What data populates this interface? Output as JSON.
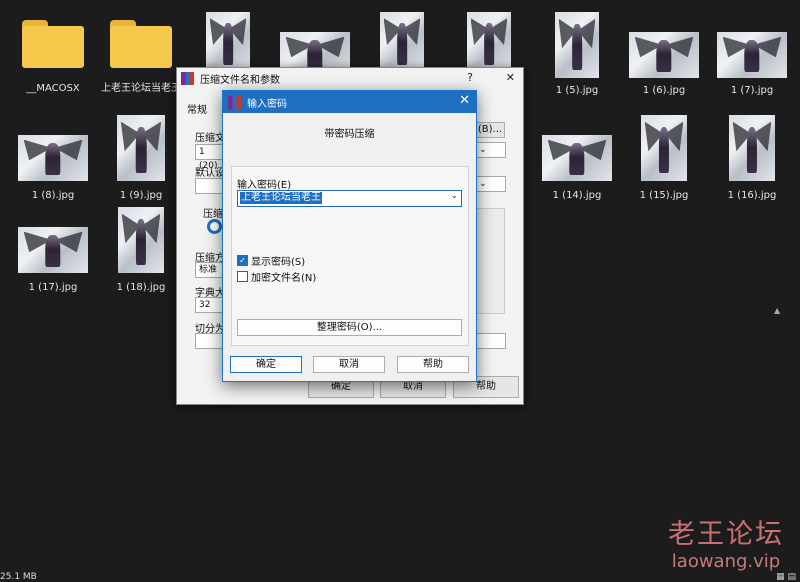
{
  "explorer": {
    "folders": [
      {
        "name": "__MACOSX"
      },
      {
        "name": "上老王论坛当老王"
      }
    ],
    "files_row1": [
      {
        "name": "1 (5).jpg"
      },
      {
        "name": "1 (6).jpg"
      },
      {
        "name": "1 (7).jpg"
      }
    ],
    "files_row2_left": [
      {
        "name": "1 (8).jpg"
      },
      {
        "name": "1 (9).jpg"
      }
    ],
    "files_row2_right": [
      {
        "name": "1 (14).jpg"
      },
      {
        "name": "1 (15).jpg"
      },
      {
        "name": "1 (16).jpg"
      }
    ],
    "files_row3": [
      {
        "name": "1 (17).jpg"
      },
      {
        "name": "1 (18).jpg"
      }
    ]
  },
  "archive_dialog": {
    "title": "压缩文件名和参数",
    "help_glyph": "?",
    "close_glyph": "✕",
    "tab_general": "常规",
    "label_archive": "压缩文",
    "archive_value": "1 (20).",
    "browse_button": "(B)...",
    "label_default": "默认设",
    "label_format": "压缩",
    "label_method": "压缩方",
    "method_value": "标准",
    "label_dict": "字典大",
    "dict_value": "32",
    "label_split": "切分为",
    "ok": "确定",
    "cancel": "取消",
    "help": "帮助"
  },
  "password_dialog": {
    "title": "输入密码",
    "close_glyph": "✕",
    "heading": "带密码压缩",
    "password_label": "输入密码(E)",
    "password_value": "上老王论坛当老王",
    "show_password": {
      "label": "显示密码(S)",
      "checked": true
    },
    "encrypt_names": {
      "label": "加密文件名(N)",
      "checked": false
    },
    "organize_button": "整理密码(O)...",
    "ok": "确定",
    "cancel": "取消",
    "help": "帮助"
  },
  "watermark": {
    "cn": "老王论坛",
    "en": "laowang.vip"
  },
  "statusbar": {
    "size": "25.1 MB"
  },
  "icons": [
    "folder-icon",
    "image-thumbnail",
    "winrar-icon",
    "chevron-down-icon",
    "check-icon",
    "close-icon"
  ]
}
